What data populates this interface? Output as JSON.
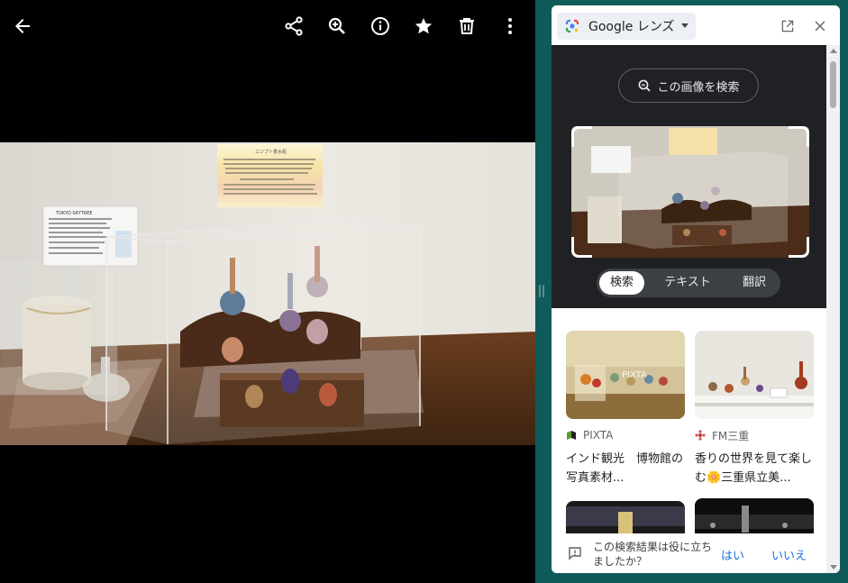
{
  "viewer": {
    "toolbar_icons": [
      "back-arrow-icon",
      "share-icon",
      "zoom-in-icon",
      "info-icon",
      "star-icon",
      "delete-icon",
      "more-vert-icon"
    ],
    "photo_text": {
      "display_sign_title": "エジプト香水瓶",
      "info_card_title": "TOKYO SKYTREE"
    }
  },
  "lens": {
    "title": "Google レンズ",
    "search_image_button": "この画像を検索",
    "modes": [
      "検索",
      "テキスト",
      "翻訳"
    ],
    "active_mode": "検索",
    "results": [
      {
        "source": "PIXTA",
        "title": "インド観光　博物館の写真素材..."
      },
      {
        "source": "FM三重",
        "title": "香りの世界を見て楽しむ🌼三重県立美..."
      }
    ],
    "feedback": {
      "question": "この検索結果は役に立ちましたか？",
      "yes": "はい",
      "no": "いいえ"
    }
  },
  "colors": {
    "frame": "#0f5b5a",
    "lens_dark": "#202124",
    "link_blue": "#1a73e8"
  }
}
